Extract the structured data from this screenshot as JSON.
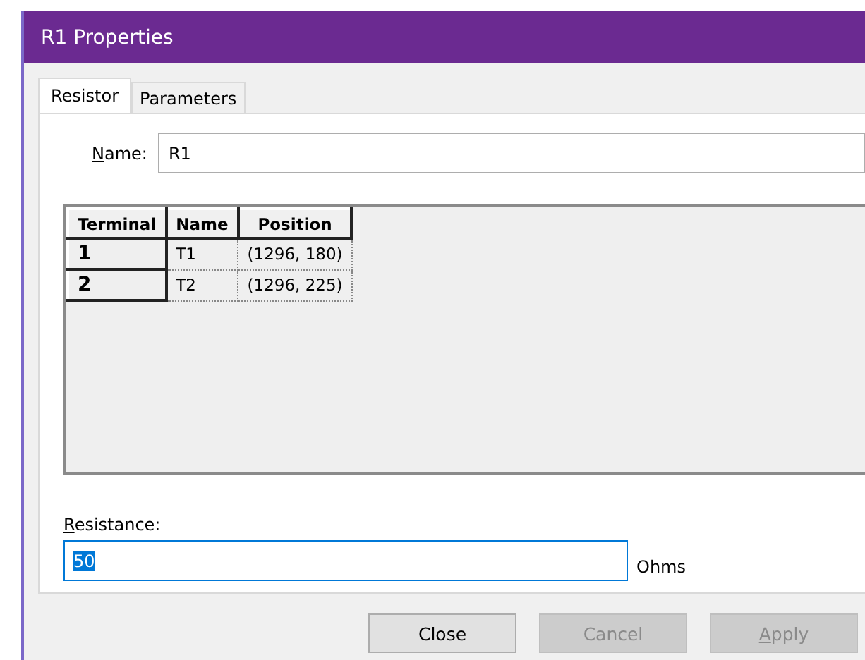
{
  "window": {
    "title": "R1 Properties"
  },
  "tabs": [
    {
      "label": "Resistor",
      "selected": true
    },
    {
      "label": "Parameters",
      "selected": false
    }
  ],
  "name_field": {
    "label": "Name:",
    "access_key_underlined": true,
    "value": "R1"
  },
  "table": {
    "columns": [
      "Terminal",
      "Name",
      "Position"
    ],
    "rows": [
      [
        "1",
        "T1",
        "(1296, 180)"
      ],
      [
        "2",
        "T2",
        "(1296, 225)"
      ]
    ]
  },
  "resistance_field": {
    "label": "Resistance:",
    "access_key_underlined": true,
    "value": "50",
    "focused": true,
    "text_selected": true,
    "unit": "Ohms"
  },
  "buttons": [
    {
      "label": "Close",
      "disabled": false,
      "access_key_underlined": false
    },
    {
      "label": "Cancel",
      "disabled": true,
      "access_key_underlined": false
    },
    {
      "label": "Apply",
      "disabled": true,
      "access_key_underlined": true
    }
  ]
}
